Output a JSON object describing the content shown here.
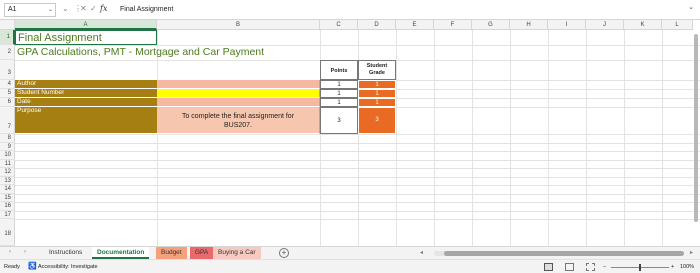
{
  "formula_bar": {
    "name_box": "A1",
    "formula_value": "Final Assignment"
  },
  "columns": [
    "A",
    "B",
    "C",
    "D",
    "E",
    "F",
    "G",
    "H",
    "I",
    "J",
    "K",
    "L"
  ],
  "rows": [
    "1",
    "2",
    "3",
    "4",
    "5",
    "6",
    "7",
    "8",
    "9",
    "10",
    "11",
    "12",
    "13",
    "14",
    "15",
    "16",
    "17",
    "18"
  ],
  "sheet": {
    "title": "Final Assignment",
    "subtitle": "GPA Calculations, PMT - Mortgage and Car Payment",
    "points_header": "Points",
    "grade_header": "Student Grade",
    "rows": [
      {
        "label": "Author",
        "value": "",
        "points": "1",
        "grade": "1"
      },
      {
        "label": "Student Number",
        "value": "",
        "points": "1",
        "grade": "1"
      },
      {
        "label": "Date",
        "value": "",
        "points": "1",
        "grade": "1"
      },
      {
        "label": "Purpose",
        "value": "To complete the final assignment for BUS207.",
        "points": "3",
        "grade": "3"
      }
    ]
  },
  "tabs": [
    {
      "label": "Instructions",
      "active": false,
      "color": ""
    },
    {
      "label": "Documentation",
      "active": true,
      "color": "#ffffff"
    },
    {
      "label": "Budget",
      "active": false,
      "color": "#f4a07a"
    },
    {
      "label": "GPA",
      "active": false,
      "color": "#e86a6a"
    },
    {
      "label": "Buying a Car",
      "active": false,
      "color": "#f7c9c0"
    }
  ],
  "status": {
    "ready": "Ready",
    "accessibility": "Accessibility: Investigate",
    "zoom": "100%"
  },
  "colors": {
    "label_fill": "#a67f12",
    "author_fill": "#f6b8a2",
    "student_number_fill": "#ffff00",
    "purpose_fill": "#f6c7ae",
    "grade_fill": "#e86a23",
    "title_text": "#4d7b1d",
    "excel_green": "#217346"
  }
}
